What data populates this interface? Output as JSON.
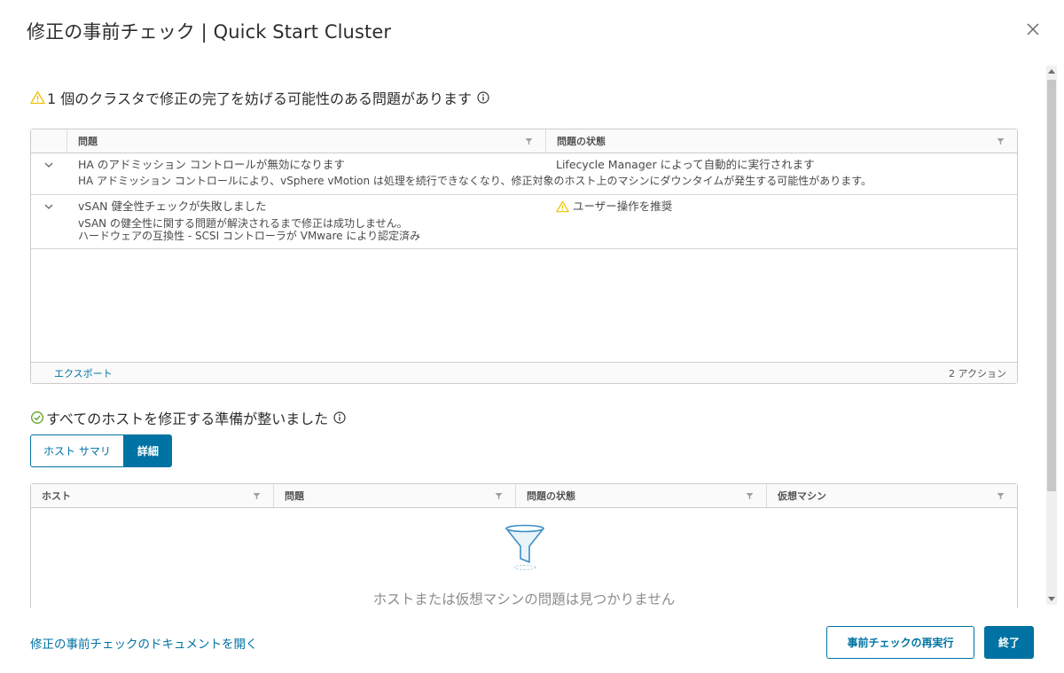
{
  "dialog": {
    "title": "修正の事前チェック | Quick Start Cluster"
  },
  "cluster_section": {
    "heading": "1 個のクラスタで修正の完了を妨げる可能性のある問題があります",
    "columns": [
      "問題",
      "問題の状態"
    ],
    "rows": [
      {
        "issue": "HA のアドミッション コントロールが無効になります",
        "state": "Lifecycle Manager によって自動的に実行されます",
        "state_icon": "",
        "details": [
          "HA アドミッション コントロールにより、vSphere vMotion は処理を続行できなくなり、修正対象のホスト上のマシンにダウンタイムが発生する可能性があります。"
        ]
      },
      {
        "issue": "vSAN 健全性チェックが失敗しました",
        "state": "ユーザー操作を推奨",
        "state_icon": "warning-icon",
        "details": [
          "vSAN の健全性に関する問題が解決されるまで修正は成功しません。",
          "ハードウェアの互換性 - SCSI コントローラが VMware により認定済み"
        ]
      }
    ],
    "export_label": "エクスポート",
    "actions_count": "2 アクション"
  },
  "hosts_section": {
    "heading": "すべてのホストを修正する準備が整いました",
    "tabs": [
      "ホスト サマリ",
      "詳細"
    ],
    "active_tab": "詳細",
    "columns": [
      "ホスト",
      "問題",
      "問題の状態",
      "仮想マシン"
    ],
    "empty_message": "ホストまたは仮想マシンの問題は見つかりません"
  },
  "footer": {
    "doc_link": "修正の事前チェックのドキュメントを開く",
    "rerun_button": "事前チェックの再実行",
    "finish_button": "終了"
  },
  "colors": {
    "accent": "#0072a3",
    "warning": "#efc006",
    "success": "#5aa220"
  }
}
